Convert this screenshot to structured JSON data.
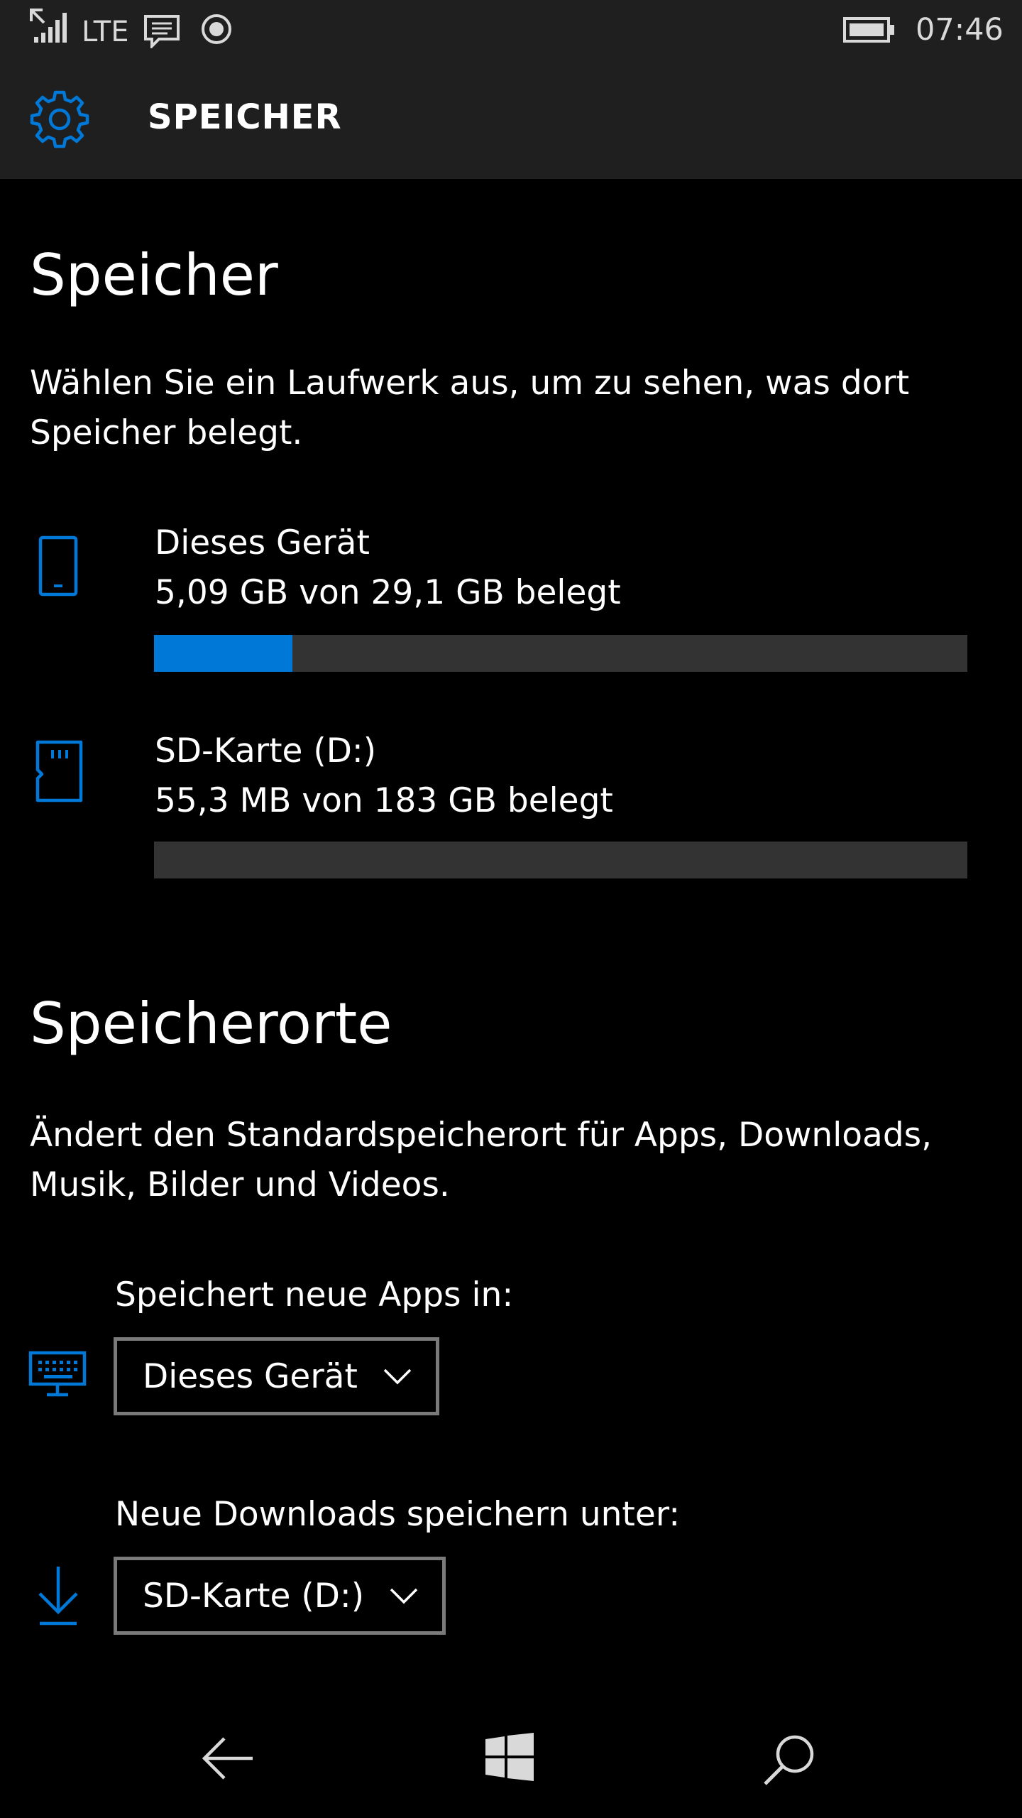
{
  "status_bar": {
    "network": "LTE",
    "time": "07:46",
    "battery_level": 1.0
  },
  "header": {
    "title": "SPEICHER",
    "icon": "gear-icon"
  },
  "storage": {
    "title": "Speicher",
    "description": "Wählen Sie ein Laufwerk aus, um zu sehen, was dort Speicher belegt.",
    "drives": [
      {
        "icon": "phone-icon",
        "name": "Dieses Gerät",
        "usage": "5,09 GB von 29,1 GB belegt",
        "used_fraction": 0.17
      },
      {
        "icon": "sd-card-icon",
        "name": "SD-Karte (D:)",
        "usage": "55,3 MB von 183 GB belegt",
        "used_fraction": 0.0
      }
    ]
  },
  "locations": {
    "title": "Speicherorte",
    "description": "Ändert den Standardspeicherort für Apps, Downloads, Musik, Bilder und Videos.",
    "settings": [
      {
        "icon": "monitor-keyboard-icon",
        "label": "Speichert neue Apps in:",
        "selected": "Dieses Gerät"
      },
      {
        "icon": "download-icon",
        "label": "Neue Downloads speichern unter:",
        "selected": "SD-Karte (D:)"
      }
    ]
  },
  "nav_bar": {
    "back": "back-arrow-icon",
    "home": "windows-icon",
    "search": "search-icon"
  },
  "colors": {
    "accent": "#0078d7",
    "background": "#000000",
    "chrome": "#1f1f1f",
    "bar_track": "#333333"
  }
}
